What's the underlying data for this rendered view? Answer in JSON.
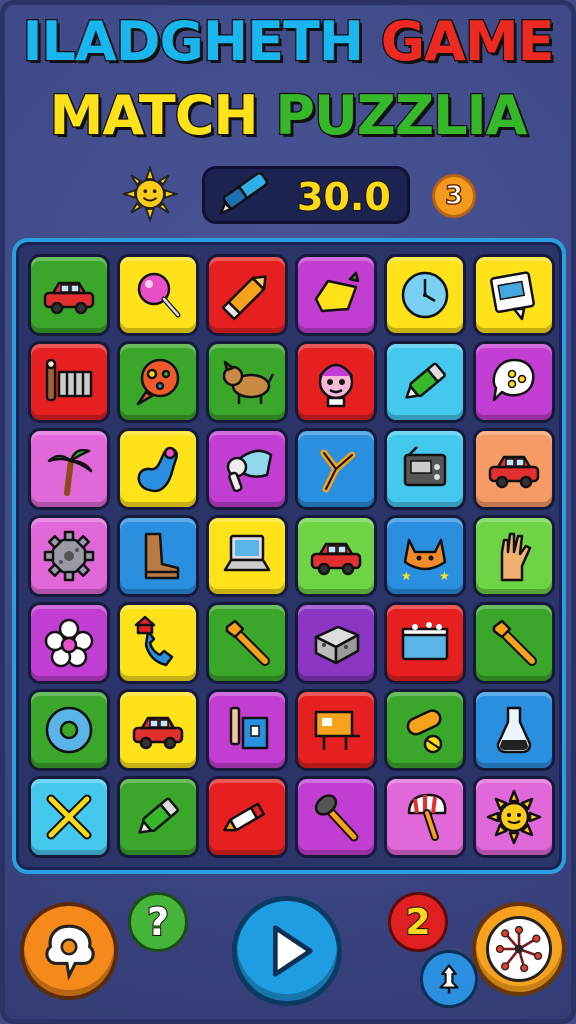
{
  "title": {
    "line1": [
      {
        "text": "ILADGHETH ",
        "color": "#19b6f0"
      },
      {
        "text": "GAME",
        "color": "#ec2a22"
      }
    ],
    "line2": [
      {
        "text": "MATCH ",
        "color": "#ffe21a"
      },
      {
        "text": "PUZZLIA",
        "color": "#35b82a"
      }
    ]
  },
  "hud": {
    "score": "30.0",
    "level_badge": "3"
  },
  "board": {
    "tiles": [
      {
        "color": "#3aa62a",
        "icon": "car-icon"
      },
      {
        "color": "#ffe21a",
        "icon": "lollipop-icon"
      },
      {
        "color": "#e62020",
        "icon": "crayon-icon"
      },
      {
        "color": "#c23ed2",
        "icon": "lemon-icon"
      },
      {
        "color": "#ffe21a",
        "icon": "clock-icon"
      },
      {
        "color": "#ffe21a",
        "icon": "picture-card-icon"
      },
      {
        "color": "#e62020",
        "icon": "gate-icon"
      },
      {
        "color": "#3aa62a",
        "icon": "balloon-icon"
      },
      {
        "color": "#3aa62a",
        "icon": "dog-icon"
      },
      {
        "color": "#e62020",
        "icon": "doll-icon"
      },
      {
        "color": "#44c8ee",
        "icon": "marker-icon"
      },
      {
        "color": "#c23ed2",
        "icon": "speech-bubble-icon"
      },
      {
        "color": "#e068d8",
        "icon": "palm-tree-icon"
      },
      {
        "color": "#ffe21a",
        "icon": "blob-icon"
      },
      {
        "color": "#c23ed2",
        "icon": "hair-dryer-icon"
      },
      {
        "color": "#2b8fe0",
        "icon": "slingshot-icon"
      },
      {
        "color": "#44c8ee",
        "icon": "radio-icon"
      },
      {
        "color": "#f59a64",
        "icon": "car-icon"
      },
      {
        "color": "#e068d8",
        "icon": "gear-icon"
      },
      {
        "color": "#2b8fe0",
        "icon": "boot-icon"
      },
      {
        "color": "#ffe21a",
        "icon": "laptop-icon"
      },
      {
        "color": "#6fd346",
        "icon": "car-icon"
      },
      {
        "color": "#2b8fe0",
        "icon": "cat-icon"
      },
      {
        "color": "#6fd346",
        "icon": "glove-icon"
      },
      {
        "color": "#c23ed2",
        "icon": "flower-icon"
      },
      {
        "color": "#ffe21a",
        "icon": "phone-icon"
      },
      {
        "color": "#3aa62a",
        "icon": "wrench-icon"
      },
      {
        "color": "#8a36c2",
        "icon": "brick-icon"
      },
      {
        "color": "#e62020",
        "icon": "tub-icon"
      },
      {
        "color": "#3aa62a",
        "icon": "wrench-icon"
      },
      {
        "color": "#3aa62a",
        "icon": "donut-icon"
      },
      {
        "color": "#ffe21a",
        "icon": "car-icon"
      },
      {
        "color": "#c23ed2",
        "icon": "pencil-box-icon"
      },
      {
        "color": "#e62020",
        "icon": "sign-icon"
      },
      {
        "color": "#3aa62a",
        "icon": "pipe-icon"
      },
      {
        "color": "#2b8fe0",
        "icon": "flask-icon"
      },
      {
        "color": "#44c8ee",
        "icon": "crossed-bones-icon"
      },
      {
        "color": "#3aa62a",
        "icon": "marker-icon"
      },
      {
        "color": "#e62020",
        "icon": "pen-icon"
      },
      {
        "color": "#c23ed2",
        "icon": "hammer-icon"
      },
      {
        "color": "#e068d8",
        "icon": "ice-cream-icon"
      },
      {
        "color": "#e068d8",
        "icon": "sun-icon"
      }
    ]
  },
  "controls": {
    "help": "?",
    "hint_count": "2"
  }
}
